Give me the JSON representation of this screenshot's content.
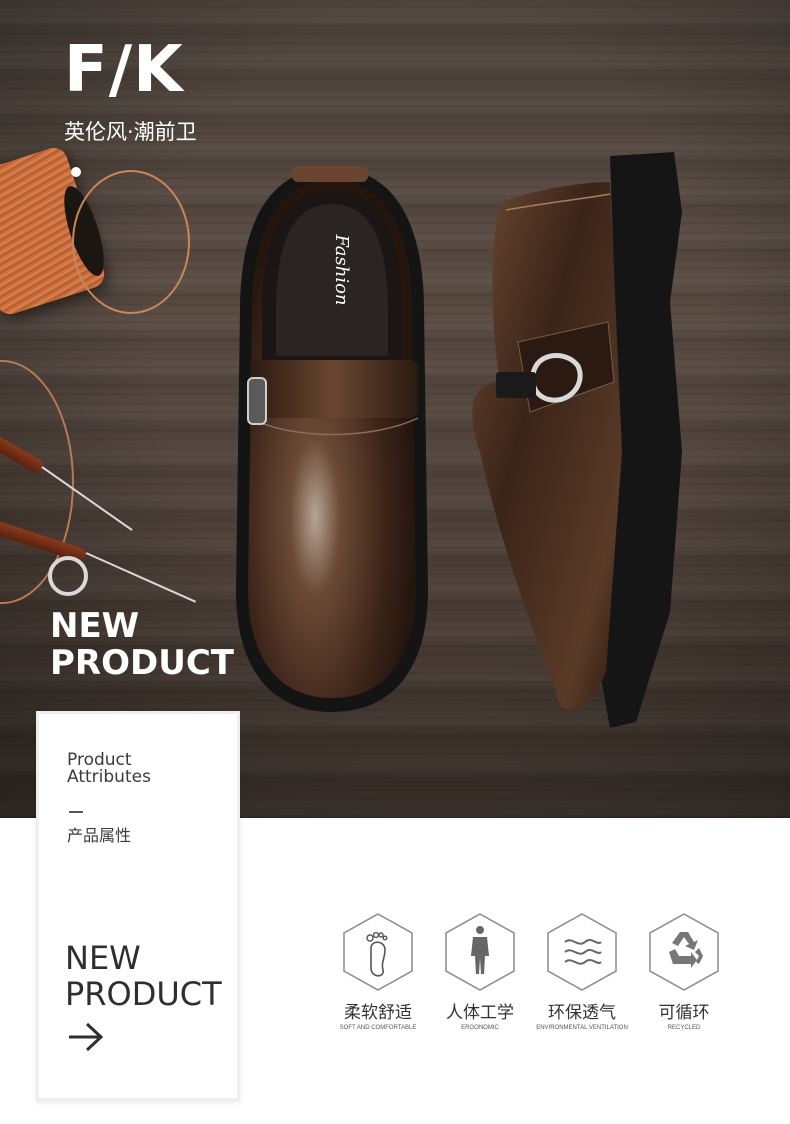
{
  "brand": {
    "logo": "F/K",
    "tagline": "英伦风·潮前卫"
  },
  "hero": {
    "title_line1": "NEW",
    "title_line2": "PRODUCT",
    "insole_text": "Fashion"
  },
  "attributes_card": {
    "heading_line1": "Product",
    "heading_line2": "Attributes",
    "heading_cn": "产品属性",
    "title_line1": "NEW",
    "title_line2": "PRODUCT"
  },
  "features": [
    {
      "icon": "footprint-icon",
      "label": "柔软舒适",
      "sub": "SOFT AND COMFORTABLE"
    },
    {
      "icon": "human-body-icon",
      "label": "人体工学",
      "sub": "ERGONOMIC"
    },
    {
      "icon": "airflow-icon",
      "label": "环保透气",
      "sub": "ENVIRONMENTAL VENTILATION"
    },
    {
      "icon": "recycle-icon",
      "label": "可循环",
      "sub": "RECYCLED"
    }
  ],
  "colors": {
    "wood": "#4e433c",
    "leather": "#4a2e1e",
    "sole": "#1a1a1a",
    "text_dark": "#333333",
    "white": "#ffffff"
  }
}
